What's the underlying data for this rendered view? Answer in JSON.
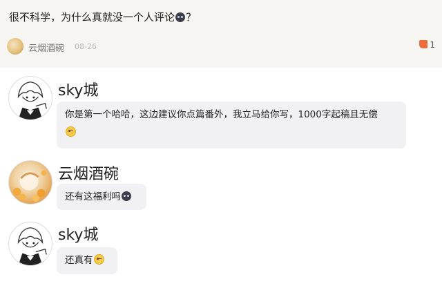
{
  "post": {
    "text_before": "很不科学，为什么真就没一个人评论",
    "text_after": "？",
    "emoji": "dark-face-emoji",
    "author": "云烟酒碗",
    "date": "08-26",
    "likes": "1"
  },
  "comments": [
    {
      "name": "sky城",
      "avatar": "manga-boy-avatar",
      "text": "你是第一个哈哈，这边建议你点篇番外，我立马给你写，1000字起稿且无偿",
      "emoji": "wink-emoji"
    },
    {
      "name": "云烟酒碗",
      "avatar": "flower-girl-avatar",
      "text": "还有这福利吗",
      "emoji": "dark-face-emoji"
    },
    {
      "name": "sky城",
      "avatar": "manga-boy-avatar",
      "text": "还真有",
      "emoji": "wink-emoji"
    }
  ],
  "colors": {
    "header_bg": "#f6f5f2",
    "bubble_bg": "#f1f1f3",
    "like_accent": "#ee6d3c"
  }
}
